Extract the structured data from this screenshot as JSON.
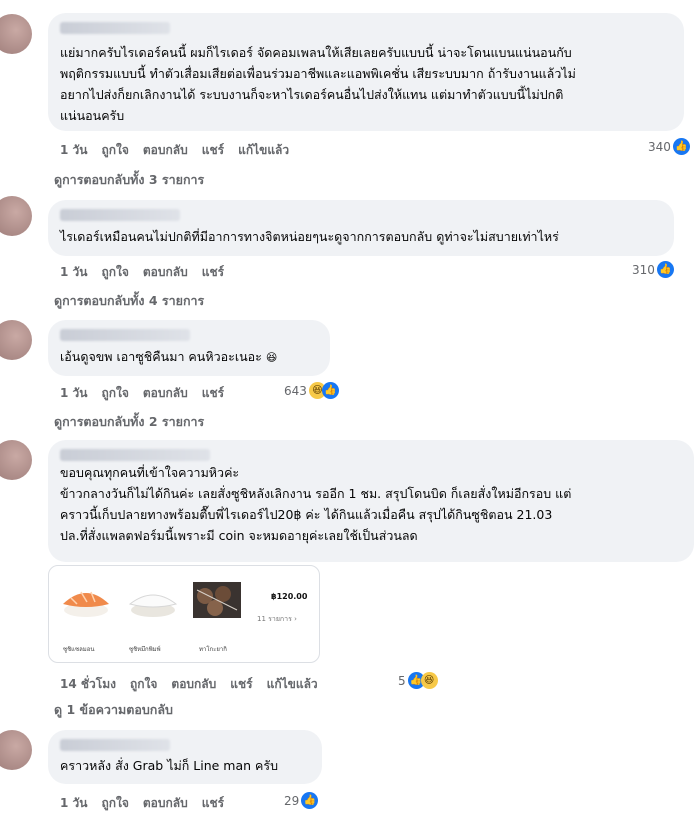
{
  "actions": {
    "like": "ถูกใจ",
    "reply": "ตอบกลับ",
    "share": "แชร์",
    "edited": "แก้ไขแล้ว"
  },
  "comments": [
    {
      "text": "แย่มากครับไรเดอร์คนนี้ ผมก็ไรเดอร์ จัดคอมเพลนให้เสียเลยครับแบบนี้ น่าจะโดนแบนแน่นอนกับ\nพฤติกรรมแบบนี้ ทำตัวเสื่อมเสียต่อเพื่อนร่วมอาชีพและแอพพิเคชั่น เสียระบบมาก ถ้ารับงานแล้วไม่\nอยากไปส่งก็ยกเลิกงานได้ ระบบงานก็จะหาไรเดอร์คนอื่นไปส่งให้แทน แต่มาทำตัวแบบนี้ไม่ปกติ\nแน่นอนครับ",
      "time": "1 วัน",
      "reactions": "340",
      "view_replies": "ดูการตอบกลับทั้ง 3 รายการ"
    },
    {
      "text": "ไรเดอร์เหมือนคนไม่ปกติที่มีอาการทางจิตหน่อยๆนะดูจากการตอบกลับ ดูท่าจะไม่สบายเท่าไหร่",
      "time": "1 วัน",
      "reactions": "310",
      "view_replies": "ดูการตอบกลับทั้ง 4 รายการ"
    },
    {
      "text": "เอ้นดูจขพ เอาซูชิคืนมา คนหิวอะเนอะ",
      "time": "1 วัน",
      "reactions": "643",
      "view_replies": "ดูการตอบกลับทั้ง 2 รายการ"
    },
    {
      "text": "ขอบคุณทุกคนที่เข้าใจความหิวค่ะ\nข้าวกลางวันก็ไม่ได้กินค่ะ เลยสั่งซูชิหลังเลิกงาน รออีก 1 ชม. สรุปโดนบิด ก็เลยสั่งใหม่อีกรอบ แต่\nคราวนี้เก็บปลายทางพร้อมตื๊บพี่ไรเดอร์ไป20฿ ค่ะ ได้กินแล้วเมื่อคืน สรุปได้กินซูชิตอน 21.03\nปล.ที่สั่งแพลตฟอร์มนี้เพราะมี coin จะหมดอายุค่ะเลยใช้เป็นส่วนลด",
      "time": "14 ชั่วโมง",
      "reactions": "5",
      "view_replies": "ดู 1 ข้อความตอบกลับ"
    },
    {
      "text": "คราวหลัง สั่ง Grab ไม่ก็ Line man ครับ",
      "time": "1 วัน",
      "reactions": "29"
    }
  ],
  "attachment": {
    "price": "฿120.00",
    "items": "11 รายการ ›",
    "labels": [
      "ซูชิแซลมอน",
      "ซูชิหมึกพิมพ์",
      "ทาโกะยากิ"
    ]
  },
  "colors": {
    "bubble": "#f0f2f5",
    "like": "#1877f2",
    "meta": "#65676b"
  }
}
